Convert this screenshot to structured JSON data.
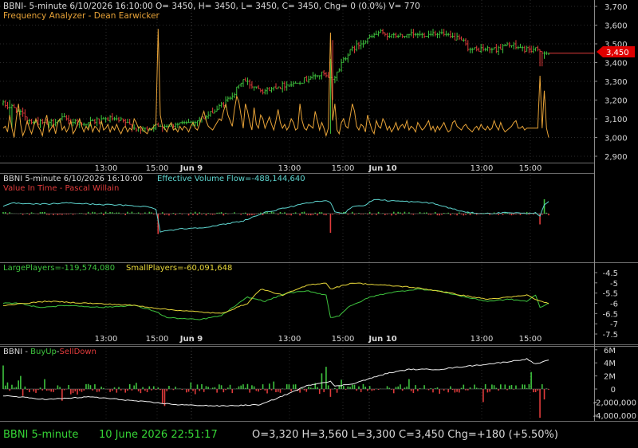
{
  "colors": {
    "background": "#000000",
    "grid": "#2a2a2a",
    "divider": "#9a9a9a",
    "text": "#d8d8d8",
    "green": "#3ec43e",
    "red": "#e03b3b",
    "yellow": "#e8d83a",
    "orange": "#e8a338",
    "cyan": "#5ed6d0",
    "white": "#f0f0f0",
    "status_green": "#36d636",
    "price_tag": "#e00000"
  },
  "header": {
    "symbol_line": "BBNI- 5-minute 6/10/2026 16:10:00 O= 3450, H= 3450, L= 3450, C= 3450, Chg= 0 (0.0%) V= 770",
    "indicator_title": "Frequency Analyzer - Dean Earwicker"
  },
  "panel2": {
    "title_left": "BBNI 5-minute  6/10/2026 16:10:00",
    "title_right": "Effective Volume Flow=-488,144,640",
    "subtitle": "Value In Time - Pascal Willain"
  },
  "panel3": {
    "large_label": "LargePlayers=-119,574,080",
    "small_label": "SmallPlayers=-60,091,648"
  },
  "panel4": {
    "symbol": "BBNI - ",
    "buy_label": "BuyUp",
    "dash": "-",
    "sell_label": "SellDown"
  },
  "status_bar": {
    "symbol_tf": "BBNI  5-minute",
    "datetime": "10 June 2026 22:51:17",
    "ohlc": "O=3,320  H=3,560  L=3,300  C=3,450  Chg=+180 (+5.50%)"
  },
  "time_axis": {
    "top": [
      "13:00",
      "15:00",
      "Jun 9",
      "13:00",
      "15:00",
      "Jun 10",
      "13:00",
      "15:00"
    ],
    "bottom": [
      "13:00",
      "15:00",
      "Jun 9",
      "13:00",
      "15:00",
      "Jun 10",
      "13:00",
      "15:00"
    ]
  },
  "price_tag_value": "3,450",
  "chart_data": [
    {
      "type": "candlestick",
      "panel": "price",
      "ylim": [
        2850,
        3700
      ],
      "y_ticks": [
        "3,700",
        "3,600",
        "3,500",
        "3,400",
        "3,300",
        "3,200",
        "3,100",
        "3,000",
        "2,900"
      ],
      "close_anchors": [
        [
          0,
          3180
        ],
        [
          6,
          3150
        ],
        [
          12,
          3090
        ],
        [
          20,
          3070
        ],
        [
          28,
          3100
        ],
        [
          36,
          3070
        ],
        [
          48,
          3100
        ],
        [
          56,
          3080
        ],
        [
          62,
          3040
        ],
        [
          66,
          3050
        ],
        [
          76,
          3070
        ],
        [
          86,
          3080
        ],
        [
          94,
          3120
        ],
        [
          100,
          3170
        ],
        [
          106,
          3240
        ],
        [
          110,
          3310
        ],
        [
          114,
          3280
        ],
        [
          120,
          3250
        ],
        [
          126,
          3270
        ],
        [
          136,
          3300
        ],
        [
          146,
          3340
        ],
        [
          150,
          3310
        ],
        [
          152,
          3320
        ],
        [
          156,
          3420
        ],
        [
          160,
          3470
        ],
        [
          166,
          3520
        ],
        [
          172,
          3560
        ],
        [
          180,
          3540
        ],
        [
          192,
          3550
        ],
        [
          200,
          3560
        ],
        [
          206,
          3530
        ],
        [
          210,
          3520
        ],
        [
          214,
          3470
        ],
        [
          224,
          3470
        ],
        [
          228,
          3480
        ],
        [
          232,
          3500
        ],
        [
          236,
          3480
        ],
        [
          246,
          3460
        ],
        [
          250,
          3450
        ]
      ],
      "volatile_bars": [
        [
          3,
          3110,
          3200
        ],
        [
          4,
          3050,
          3180
        ],
        [
          150,
          3020,
          3420
        ],
        [
          151,
          3200,
          3520
        ],
        [
          246,
          3380,
          3470
        ],
        [
          247,
          3380,
          3460
        ],
        [
          248,
          3420,
          3460
        ]
      ],
      "last": 3450
    },
    {
      "type": "line",
      "panel": "price",
      "name": "Frequency Analyzer",
      "values_1": [
        3050,
        3060,
        3030,
        3120,
        3050,
        3000,
        3100,
        3180,
        3070,
        3010,
        3040,
        3090,
        3050,
        3020,
        3060,
        3100,
        3060,
        3040,
        3010,
        3080,
        3120,
        3030,
        3050,
        3070,
        3020,
        3080,
        3100,
        3040,
        3060,
        3030,
        3050,
        3090,
        3020,
        3040,
        3070,
        3100,
        3060,
        3030,
        3060,
        3040,
        3080,
        3030,
        3060,
        3050,
        3030,
        3090,
        3040,
        3050,
        3070,
        3030,
        3060,
        3040,
        3070,
        3040,
        3020,
        3050,
        3060,
        3030,
        3050,
        3040,
        3100,
        3080,
        3050,
        3060,
        3040,
        3030,
        3020,
        3050,
        3040,
        3060,
        3070,
        3050,
        3120,
        3060,
        3050,
        3030,
        3060,
        3080,
        3040,
        3050,
        3030,
        3060,
        3040,
        3060,
        3050,
        3030,
        3060,
        3080,
        3050,
        3040,
        3070,
        3110,
        3140,
        3090,
        3060,
        3050,
        3040,
        3060,
        3080,
        3100,
        3090,
        3140,
        3180,
        3120,
        3090,
        3060,
        3150,
        3220,
        3190,
        3120,
        3050,
        3180,
        3140,
        3080,
        3040,
        3160,
        3070,
        3050,
        3120,
        3100,
        3050,
        3080,
        3110,
        3070,
        3040,
        3090,
        3150,
        3080,
        3050,
        3070,
        3040,
        3060,
        3100,
        3080,
        3040,
        3050,
        3180,
        3090,
        3050,
        3040,
        3070,
        3060,
        3050,
        3140,
        3090,
        3040,
        3080,
        3050
      ],
      "values_2": [
        3010,
        3050,
        3060,
        3090,
        3180,
        3040,
        3020,
        3080,
        3100,
        3060,
        3050,
        3110,
        3180,
        3140,
        3060,
        3040,
        3070,
        3060,
        3030,
        3120,
        3080,
        3040,
        3020,
        3090,
        3060,
        3050,
        3100,
        3080,
        3040,
        3060,
        3030,
        3050,
        3080,
        3040,
        3060,
        3070,
        3050,
        3090,
        3040,
        3060,
        3050,
        3030,
        3080,
        3060,
        3040,
        3050,
        3070,
        3090,
        3040,
        3060,
        3030,
        3060,
        3040,
        3060,
        3080,
        3050,
        3030,
        3040,
        3080,
        3090,
        3060,
        3050,
        3040,
        3060,
        3070,
        3050,
        3040,
        3030,
        3050,
        3060,
        3040,
        3070,
        3050,
        3040,
        3060,
        3040,
        3050,
        3090,
        3060,
        3040,
        3080,
        3050,
        3030,
        3040,
        3050,
        3060,
        3080,
        3090,
        3050,
        3050,
        3060,
        3040,
        3050,
        3050
      ],
      "spikes": [
        [
          71,
          3580
        ],
        [
          150,
          3560
        ],
        [
          164,
          3070
        ],
        [
          246,
          3330
        ],
        [
          248,
          3250
        ],
        [
          250,
          3000
        ]
      ]
    },
    {
      "type": "line",
      "panel": "effective_volume_flow",
      "name": "Effective Volume Flow",
      "ylim": [
        -1,
        1
      ],
      "anchors": [
        [
          0,
          0.3
        ],
        [
          5,
          0.45
        ],
        [
          10,
          0.4
        ],
        [
          20,
          0.4
        ],
        [
          30,
          0.45
        ],
        [
          40,
          0.4
        ],
        [
          55,
          0.35
        ],
        [
          65,
          0.3
        ],
        [
          70,
          0.2
        ],
        [
          72,
          -0.75
        ],
        [
          80,
          -0.65
        ],
        [
          95,
          -0.55
        ],
        [
          110,
          -0.3
        ],
        [
          120,
          0.05
        ],
        [
          130,
          0.25
        ],
        [
          140,
          0.45
        ],
        [
          148,
          0.55
        ],
        [
          150,
          0.45
        ],
        [
          152,
          0.1
        ],
        [
          156,
          0.0
        ],
        [
          160,
          0.3
        ],
        [
          166,
          0.35
        ],
        [
          170,
          0.6
        ],
        [
          176,
          0.55
        ],
        [
          186,
          0.5
        ],
        [
          196,
          0.45
        ],
        [
          200,
          0.35
        ],
        [
          206,
          0.2
        ],
        [
          212,
          0.05
        ],
        [
          222,
          0.0
        ],
        [
          232,
          0.05
        ],
        [
          240,
          0.0
        ],
        [
          244,
          0.05
        ],
        [
          246,
          -0.1
        ],
        [
          248,
          0.35
        ],
        [
          250,
          0.5
        ]
      ]
    },
    {
      "type": "bar",
      "panel": "value_in_time",
      "name": "Value In Time",
      "spikes": [
        [
          71,
          -0.85
        ],
        [
          150,
          -0.8
        ],
        [
          246,
          -0.45
        ],
        [
          248,
          0.6
        ]
      ]
    },
    {
      "type": "line",
      "panel": "players",
      "ylim": [
        -7.8,
        -4.2
      ],
      "y_ticks": [
        "-4.5",
        "-5",
        "-5.5",
        "-6",
        "-6.5",
        "-7",
        "-7.5"
      ],
      "series": [
        {
          "name": "LargePlayers",
          "color": "green",
          "anchors": [
            [
              0,
              -6.0
            ],
            [
              8,
              -6.0
            ],
            [
              16,
              -6.2
            ],
            [
              30,
              -6.1
            ],
            [
              45,
              -6.2
            ],
            [
              60,
              -6.1
            ],
            [
              70,
              -6.4
            ],
            [
              75,
              -6.7
            ],
            [
              90,
              -6.8
            ],
            [
              100,
              -6.6
            ],
            [
              108,
              -6.0
            ],
            [
              112,
              -5.7
            ],
            [
              120,
              -5.9
            ],
            [
              130,
              -5.5
            ],
            [
              140,
              -5.4
            ],
            [
              148,
              -5.6
            ],
            [
              150,
              -6.7
            ],
            [
              154,
              -6.6
            ],
            [
              158,
              -6.2
            ],
            [
              162,
              -6.0
            ],
            [
              168,
              -5.7
            ],
            [
              176,
              -5.5
            ],
            [
              190,
              -5.3
            ],
            [
              200,
              -5.4
            ],
            [
              212,
              -5.7
            ],
            [
              222,
              -5.9
            ],
            [
              232,
              -5.8
            ],
            [
              240,
              -5.9
            ],
            [
              244,
              -5.6
            ],
            [
              246,
              -6.2
            ],
            [
              250,
              -6.0
            ]
          ]
        },
        {
          "name": "SmallPlayers",
          "color": "yellow",
          "anchors": [
            [
              0,
              -6.1
            ],
            [
              10,
              -6.0
            ],
            [
              20,
              -5.9
            ],
            [
              40,
              -6.0
            ],
            [
              60,
              -6.1
            ],
            [
              75,
              -6.3
            ],
            [
              100,
              -6.5
            ],
            [
              112,
              -6.0
            ],
            [
              118,
              -5.3
            ],
            [
              128,
              -5.6
            ],
            [
              140,
              -5.1
            ],
            [
              148,
              -5.0
            ],
            [
              150,
              -5.3
            ],
            [
              160,
              -5.0
            ],
            [
              172,
              -5.1
            ],
            [
              186,
              -5.2
            ],
            [
              200,
              -5.4
            ],
            [
              210,
              -5.6
            ],
            [
              222,
              -5.8
            ],
            [
              232,
              -5.7
            ],
            [
              240,
              -5.6
            ],
            [
              244,
              -5.8
            ],
            [
              246,
              -5.9
            ],
            [
              250,
              -6.0
            ]
          ]
        }
      ]
    },
    {
      "type": "bar+line",
      "panel": "buyup_selldown",
      "ylim": [
        -5000000,
        7000000
      ],
      "y_ticks": [
        "6M",
        "4M",
        "2M",
        "0",
        "-2,000,000",
        "-4,000,000"
      ],
      "line_anchors": [
        [
          0,
          -1.0
        ],
        [
          20,
          -1.6
        ],
        [
          40,
          -1.2
        ],
        [
          60,
          -1.8
        ],
        [
          80,
          -2.4
        ],
        [
          100,
          -2.6
        ],
        [
          118,
          -2.4
        ],
        [
          130,
          -0.8
        ],
        [
          140,
          0.6
        ],
        [
          150,
          1.2
        ],
        [
          152,
          0.4
        ],
        [
          160,
          0.8
        ],
        [
          176,
          2.4
        ],
        [
          186,
          3.0
        ],
        [
          200,
          3.0
        ],
        [
          210,
          3.4
        ],
        [
          222,
          3.8
        ],
        [
          232,
          4.2
        ],
        [
          240,
          4.6
        ],
        [
          244,
          3.8
        ],
        [
          250,
          4.4
        ]
      ],
      "big_bars": [
        [
          0,
          3.6
        ],
        [
          8,
          2.0
        ],
        [
          27,
          -1.8
        ],
        [
          74,
          -2.6
        ],
        [
          73,
          -2.2
        ],
        [
          146,
          2.4
        ],
        [
          148,
          3.4
        ],
        [
          150,
          -1.2
        ],
        [
          220,
          -2.0
        ],
        [
          246,
          -4.4
        ],
        [
          248,
          -1.6
        ],
        [
          242,
          2.6
        ]
      ]
    }
  ]
}
